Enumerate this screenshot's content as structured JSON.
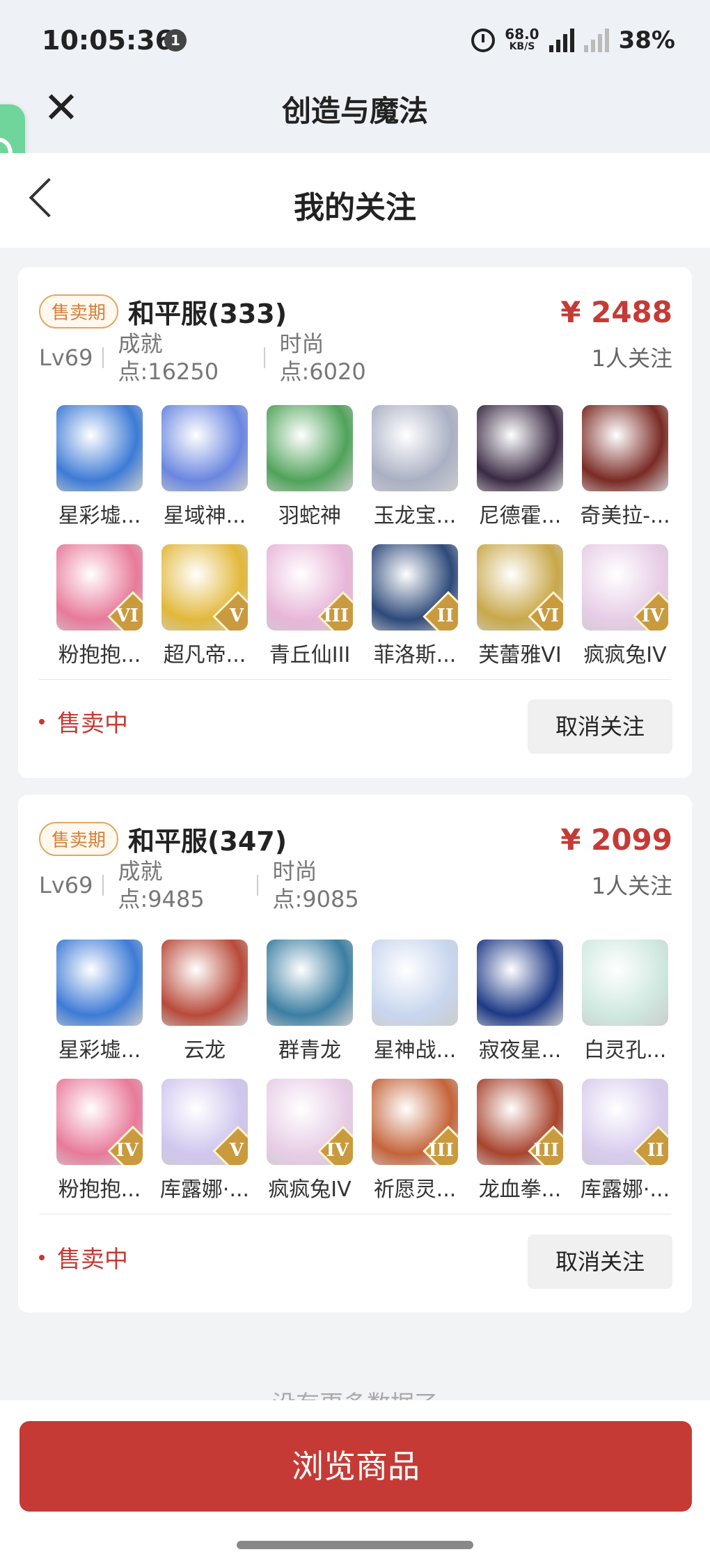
{
  "status_bar": {
    "time": "10:05:36",
    "notif_count": "1",
    "net_speed": "68.0",
    "net_unit": "KB/S",
    "network": "5G",
    "battery": "38%"
  },
  "app": {
    "title": "创造与魔法"
  },
  "nav": {
    "title": "我的关注"
  },
  "listings": [
    {
      "tag": "售卖期",
      "server": "和平服(333)",
      "price": "¥ 2488",
      "followers": "1人关注",
      "level": "Lv69",
      "achievement_label": "成就",
      "achievement_value": "点:16250",
      "fashion_label": "时尚",
      "fashion_value": "点:6020",
      "pets": [
        {
          "name": "星彩墟...",
          "color": "#3d7bd6",
          "rank": ""
        },
        {
          "name": "星域神...",
          "color": "#6a86e0",
          "rank": ""
        },
        {
          "name": "羽蛇神",
          "color": "#4fa35a",
          "rank": ""
        },
        {
          "name": "玉龙宝...",
          "color": "#aab0c4",
          "rank": ""
        },
        {
          "name": "尼德霍...",
          "color": "#3a2a44",
          "rank": ""
        },
        {
          "name": "奇美拉-...",
          "color": "#7a2a24",
          "rank": ""
        },
        {
          "name": "粉抱抱...",
          "color": "#e87a9a",
          "rank": "VI"
        },
        {
          "name": "超凡帝...",
          "color": "#e2b83a",
          "rank": "V"
        },
        {
          "name": "青丘仙III",
          "color": "#e8b6d8",
          "rank": "III"
        },
        {
          "name": "菲洛斯...",
          "color": "#2e4a7a",
          "rank": "II"
        },
        {
          "name": "芙蕾雅VI",
          "color": "#c9a84a",
          "rank": "VI"
        },
        {
          "name": "疯疯兔IV",
          "color": "#e7cde6",
          "rank": "IV"
        }
      ],
      "status": "售卖中",
      "unfollow": "取消关注"
    },
    {
      "tag": "售卖期",
      "server": "和平服(347)",
      "price": "¥ 2099",
      "followers": "1人关注",
      "level": "Lv69",
      "achievement_label": "成就",
      "achievement_value": "点:9485",
      "fashion_label": "时尚",
      "fashion_value": "点:9085",
      "pets": [
        {
          "name": "星彩墟...",
          "color": "#3d7bd6",
          "rank": ""
        },
        {
          "name": "云龙",
          "color": "#b84a3a",
          "rank": ""
        },
        {
          "name": "群青龙",
          "color": "#3b7ea2",
          "rank": ""
        },
        {
          "name": "星神战...",
          "color": "#c8d6ee",
          "rank": ""
        },
        {
          "name": "寂夜星...",
          "color": "#1e3a86",
          "rank": ""
        },
        {
          "name": "白灵孔...",
          "color": "#cfe8e0",
          "rank": ""
        },
        {
          "name": "粉抱抱...",
          "color": "#e87a9a",
          "rank": "IV"
        },
        {
          "name": "库露娜·...",
          "color": "#d0c6ee",
          "rank": "V"
        },
        {
          "name": "疯疯兔IV",
          "color": "#e7cde6",
          "rank": "IV"
        },
        {
          "name": "祈愿灵...",
          "color": "#c4643a",
          "rank": "III"
        },
        {
          "name": "龙血拳...",
          "color": "#a8442e",
          "rank": "III"
        },
        {
          "name": "库露娜·...",
          "color": "#d8ccee",
          "rank": "II"
        }
      ],
      "status": "售卖中",
      "unfollow": "取消关注"
    }
  ],
  "footer": {
    "no_more": "没有更多数据了",
    "browse": "浏览商品"
  }
}
